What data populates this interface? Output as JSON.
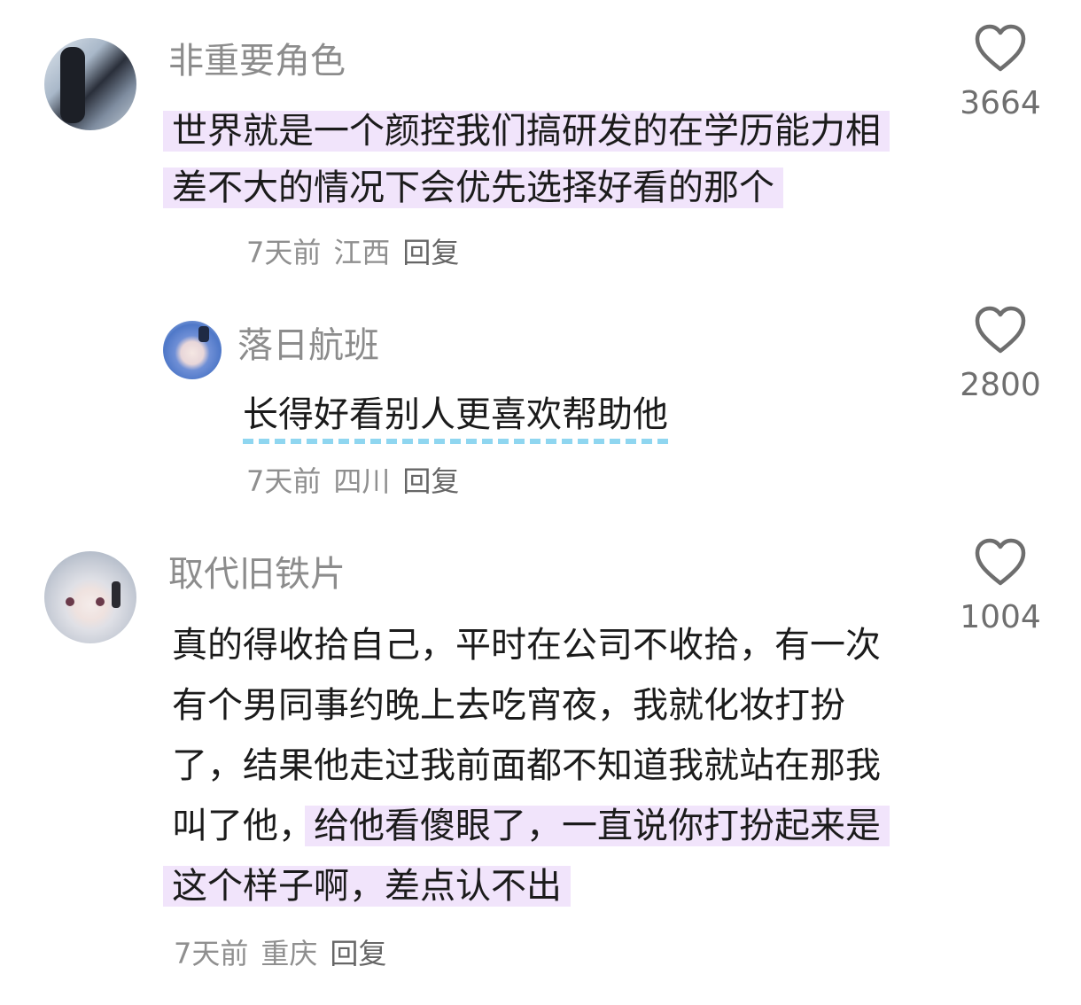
{
  "colors": {
    "highlight": "#f1e4fb",
    "dash_underline": "#8fd6f0",
    "username": "#8c8c8c",
    "meta": "#8f8f8f"
  },
  "comments": [
    {
      "username": "非重要角色",
      "text_plain": "",
      "text_highlight": "世界就是一个颜控我们搞研发的在学历能力相差不大的情况下会优先选择好看的那个",
      "time": "7天前",
      "location": "江西",
      "reply": "回复",
      "likes": "3664",
      "like_icon": "heart-outline-icon"
    },
    {
      "username": "落日航班",
      "text": "长得好看别人更喜欢帮助他",
      "time": "7天前",
      "location": "四川",
      "reply": "回复",
      "likes": "2800",
      "like_icon": "heart-outline-icon"
    },
    {
      "username": "取代旧铁片",
      "text_plain": "真的得收拾自己，平时在公司不收拾，有一次有个男同事约晚上去吃宵夜，我就化妆打扮了，结果他走过我前面都不知道我就站在那我叫了他，",
      "text_highlight": "给他看傻眼了，一直说你打扮起来是这个样子啊，差点认不出",
      "time": "7天前",
      "location": "重庆",
      "reply": "回复",
      "likes": "1004",
      "like_icon": "heart-outline-icon"
    }
  ]
}
